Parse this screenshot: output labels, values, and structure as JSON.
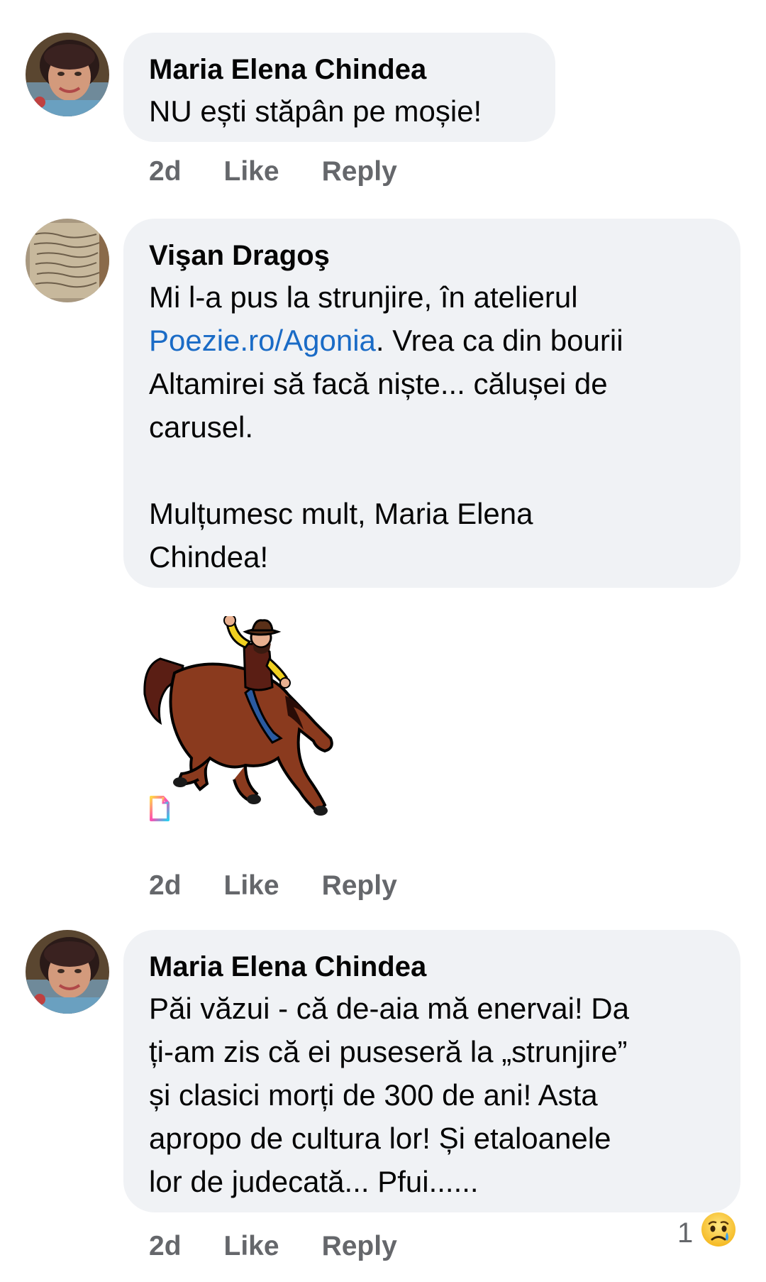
{
  "comments": [
    {
      "author": "Maria Elena Chindea",
      "text": "NU ești stăpân pe moșie!",
      "time": "2d",
      "like_label": "Like",
      "reply_label": "Reply",
      "avatar_icon": "profile-photo-woman"
    },
    {
      "author": "Vişan Dragoş",
      "text_before_link": "Mi l-a pus la strunjire, în atelierul\n",
      "link_text": "Poezie.ro/Agonia",
      "text_after_link": ". Vrea ca din bourii\nAltamirei să facă niște... călușei de\ncarusel.\n\nMulțumesc mult, Maria Elena\nChindea!",
      "sticker_icon": "cowboy-on-bucking-horse-sticker",
      "time": "2d",
      "like_label": "Like",
      "reply_label": "Reply",
      "avatar_icon": "profile-photo-handwritten-paper"
    },
    {
      "author": "Maria Elena Chindea",
      "text": "Păi văzui - că de-aia mă enervai! Da\nți-am zis că ei puseseră la „strunjire”\nși clasici morți de 300 de ani! Asta\napropo de cultura lor! Și etaloanele\nlor de judecată... Pfui......",
      "time": "2d",
      "like_label": "Like",
      "reply_label": "Reply",
      "avatar_icon": "profile-photo-woman",
      "reaction_count": "1",
      "reaction_icon": "sad-face-icon"
    }
  ]
}
